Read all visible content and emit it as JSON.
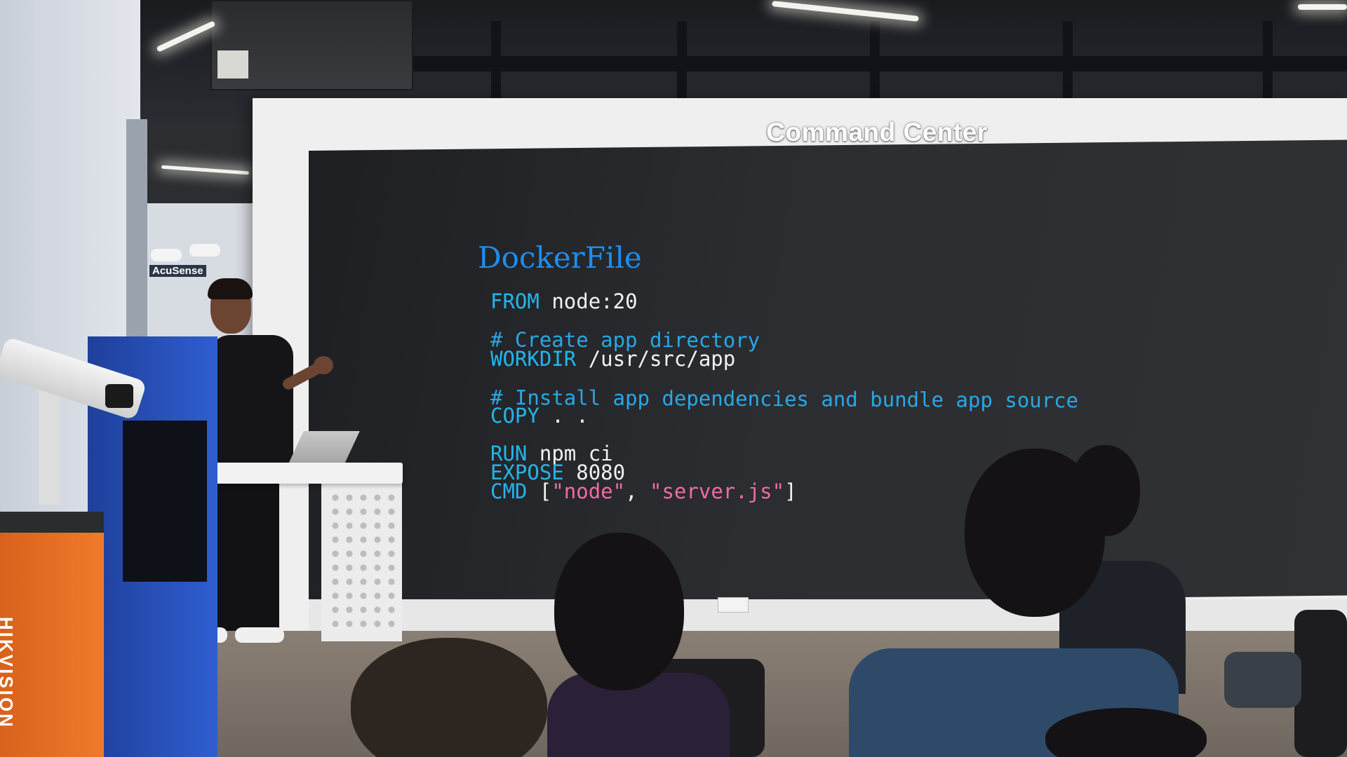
{
  "scene": {
    "wall_sign": "Command Center",
    "background_signage": "AcuSense",
    "equipment_brand": "HIKVISION"
  },
  "slide": {
    "title": "DockerFile",
    "lines": {
      "from_kw": "FROM",
      "from_val": "node:20",
      "comment1": "# Create app directory",
      "workdir_kw": "WORKDIR",
      "workdir_val": "/usr/src/app",
      "comment2": "# Install app dependencies and bundle app source",
      "copy_kw": "COPY",
      "copy_val": ". .",
      "run_kw": "RUN",
      "run_val": "npm ci",
      "expose_kw": "EXPOSE",
      "expose_val": "8080",
      "cmd_kw": "CMD",
      "cmd_open": "[",
      "cmd_arg1": "\"node\"",
      "cmd_sep": ", ",
      "cmd_arg2": "\"server.js\"",
      "cmd_close": "]"
    }
  },
  "colors": {
    "keyword": "#23b5ea",
    "string": "#f06ca6",
    "title": "#1c8ef0",
    "text": "#f2f2f2"
  }
}
